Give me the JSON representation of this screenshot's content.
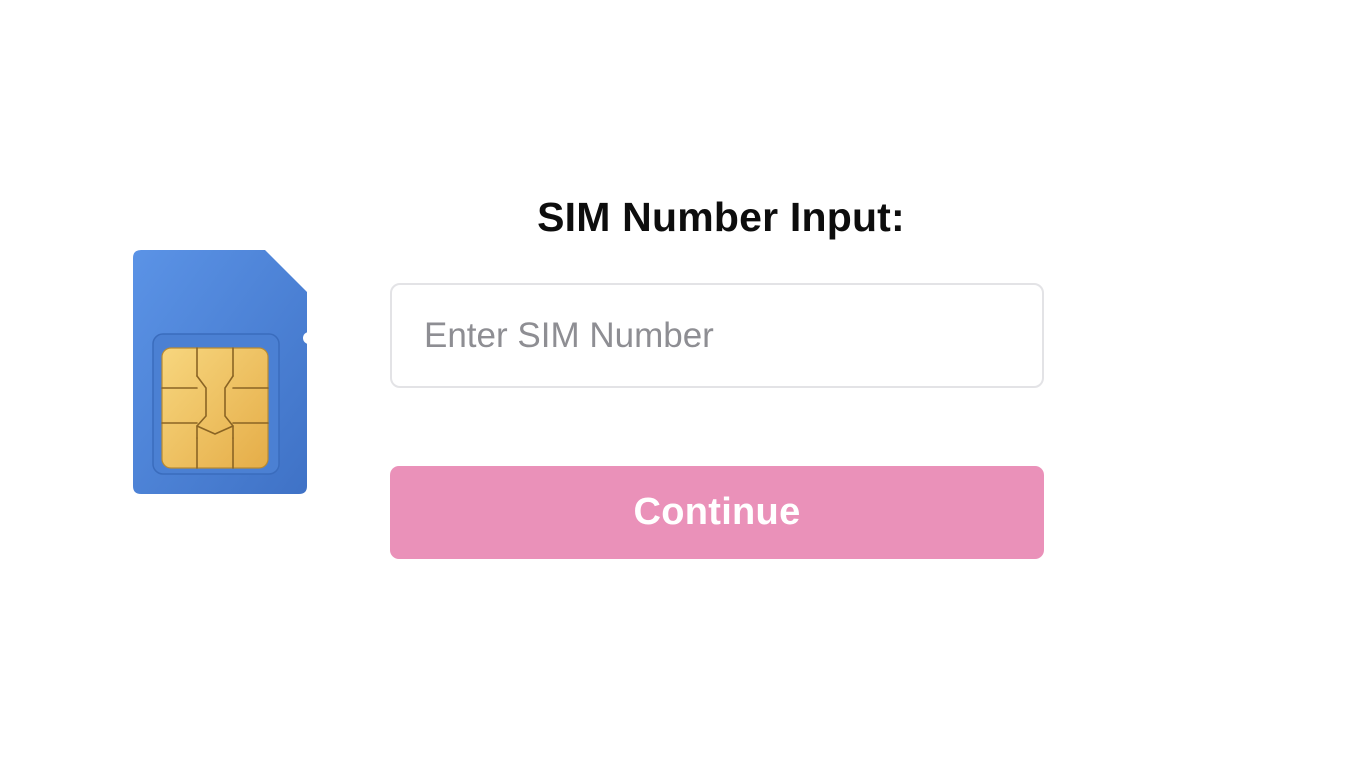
{
  "form": {
    "title": "SIM Number Input:",
    "sim_input": {
      "value": "",
      "placeholder": "Enter SIM Number"
    },
    "continue_label": "Continue"
  },
  "illustration": {
    "icon": "sim-card-icon"
  },
  "colors": {
    "sim_card_blue": "#5389dd",
    "chip_gold": "#f0c35a",
    "button_pink": "#ea91b9",
    "input_border": "#e3e3e6",
    "placeholder_gray": "#8e8e93"
  }
}
